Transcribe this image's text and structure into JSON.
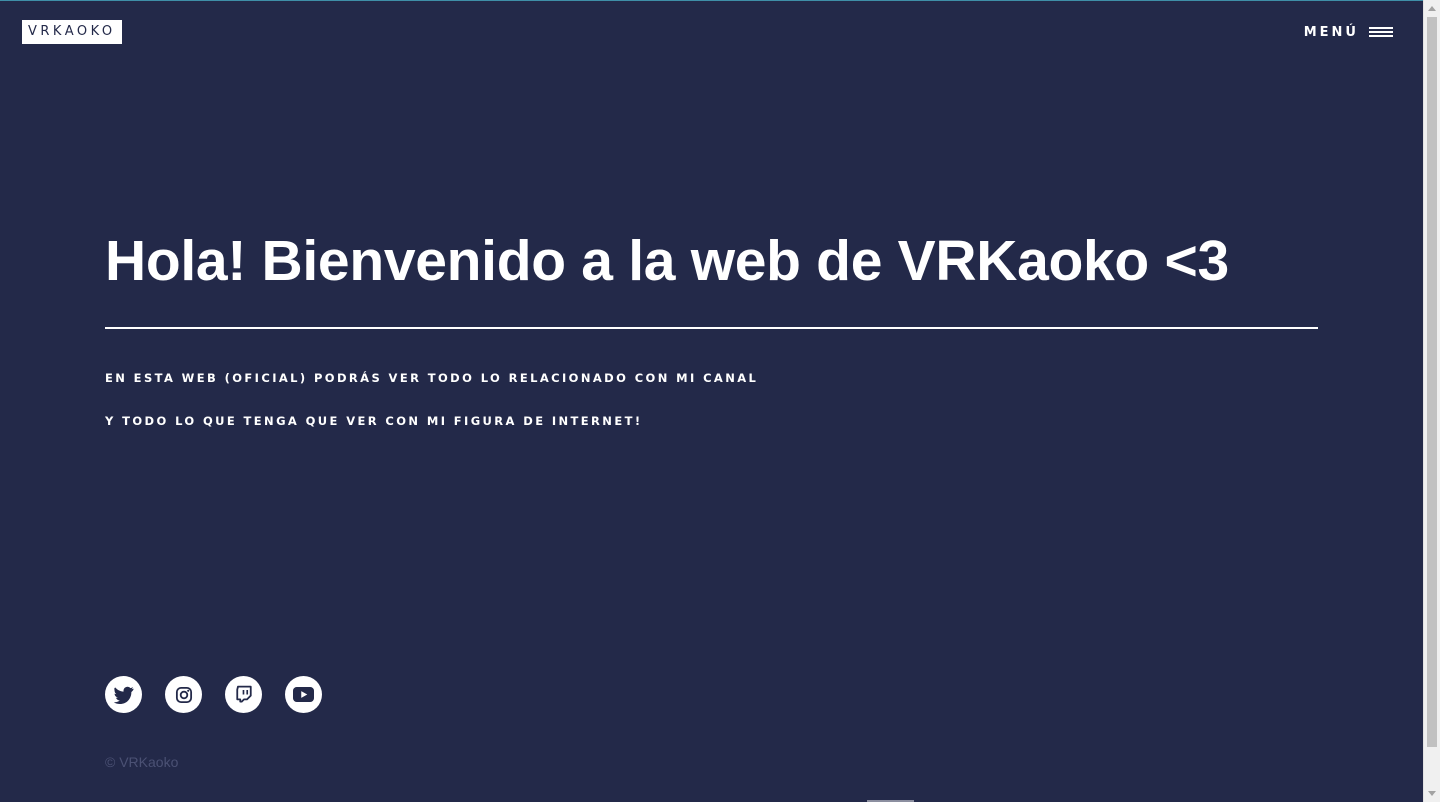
{
  "header": {
    "logo_text": "VRKAOKO",
    "menu_label": "MENÚ",
    "menu_icon": "hamburger-icon"
  },
  "hero": {
    "title": "Hola! Bienvenido a la web de VRKaoko <3",
    "line1": "EN ESTA WEB (OFICIAL) PODRÁS VER TODO LO RELACIONADO CON MI CANAL",
    "line2": "Y TODO LO QUE TENGA QUE VER CON MI FIGURA DE INTERNET!"
  },
  "socials": [
    {
      "icon": "twitter-icon"
    },
    {
      "icon": "instagram-icon"
    },
    {
      "icon": "twitch-icon"
    },
    {
      "icon": "youtube-icon"
    }
  ],
  "footer": {
    "copyright": "© VRKaoko"
  },
  "colors": {
    "background": "#232949",
    "text": "#ffffff",
    "muted": "#4b5174",
    "accent_top_line": "#3f8fa8"
  }
}
